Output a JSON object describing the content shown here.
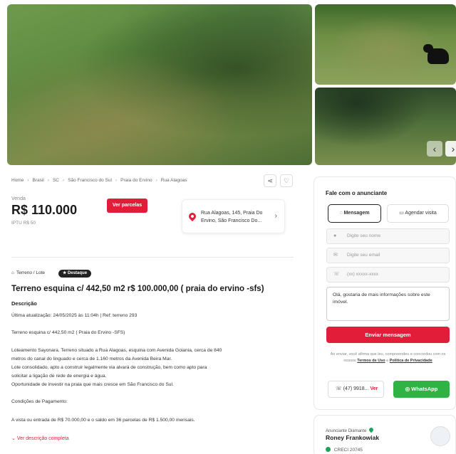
{
  "gallery": {
    "prev_icon": "chevron-left-icon",
    "next_icon": "chevron-right-icon"
  },
  "breadcrumb": [
    "Home",
    "Brasil",
    "SC",
    "São Francisco do Sul",
    "Praia do Ervino",
    "Rua Alagoas"
  ],
  "listing": {
    "sale_label": "Venda",
    "price": "R$ 110.000",
    "iptu": "IPTU R$ 50",
    "parcelas_label": "Ver parcelas",
    "address": "Rua Alagoas, 145, Praia Do Ervino, São Francisco Do...",
    "type_tag": "Terreno / Lote",
    "highlight_tag": "★ Destaque",
    "title": "Terreno esquina c/ 442,50 m2 r$ 100.000,00 ( praia do ervino -sfs)",
    "description_heading": "Descrição",
    "updated": "Última atualização: 24/05/2025 às 11:04h | Ref: terreno 293",
    "description_lines": [
      "Terreno esquina c/ 442,50 m2 ( Praia do Ervino -SFS)",
      "Loteamento Sayonara. Terreno situado a Rua Alagoas, esquina com Avenida Goiania, cerca de 840",
      "metros do canal do linguado e cerca de 1.160 metros da Avenida Beira Mar.",
      "Lote consolidado, apto a construir legalmente via alvará de construção, bem como apto para",
      "solicitar a ligação de rede de energia e água.",
      "Oportunidade de investir na praia que mais cresce em São Francisco do Sul.",
      "Condições de Pagamento:",
      "A vista ou entrada de R$ 70.000,00 e o saldo em 36 parcelas de R$ 1.500,00 mensais."
    ],
    "see_more": "Ver descrição completa"
  },
  "contact": {
    "title": "Fale com o anunciante",
    "tab_message": "Mensagem",
    "tab_visit": "Agendar visita",
    "name_placeholder": "Digite seu nome",
    "email_placeholder": "Digite seu email",
    "phone_placeholder": "(xx) xxxxx-xxxx",
    "message": "Olá, gostaria de mais informações sobre este imóvel.",
    "send_label": "Enviar mensagem",
    "legal_prefix": "Ao enviar, você afirma que leu, compreendeu e concordou com os nossos",
    "terms_link": "Termos de Uso",
    "legal_and": "e",
    "privacy_link": "Política de Privacidade",
    "phone": "(47) 9918...",
    "phone_reveal": "Ver",
    "whatsapp_label": "WhatsApp"
  },
  "advertiser": {
    "badge": "Anunciante Diamante",
    "name": "Roney Frankowiak",
    "creci": "CRECI 20745"
  },
  "colors": {
    "accent": "#e11d3a",
    "whatsapp": "#2fb344"
  }
}
